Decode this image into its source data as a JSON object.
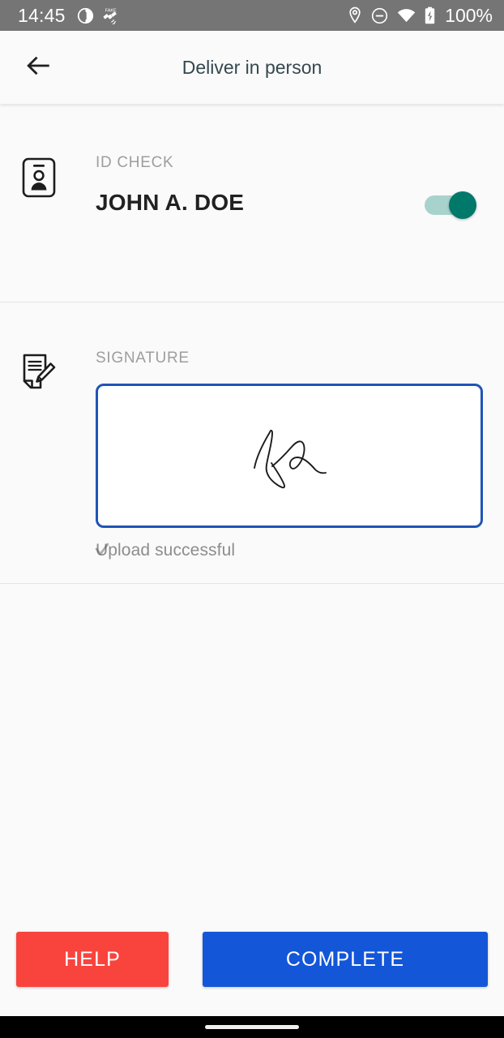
{
  "status_bar": {
    "time": "14:45",
    "battery_percent": "100%",
    "left_icons": [
      "notification-app-icon",
      "fake-gps-satellite-icon"
    ],
    "right_icons": [
      "location-pin-icon",
      "do-not-disturb-icon",
      "wifi-icon",
      "battery-charging-icon"
    ],
    "background_color": "#757575",
    "foreground_color": "#ffffff"
  },
  "app_bar": {
    "title": "Deliver in person",
    "back_icon": "arrow-left-icon"
  },
  "id_check": {
    "label": "ID CHECK",
    "name": "JOHN A. DOE",
    "icon": "id-badge-icon",
    "toggle_state": "on",
    "toggle_thumb_color": "#00796b",
    "toggle_track_color": "#a8d3cc"
  },
  "signature": {
    "label": "SIGNATURE",
    "icon": "document-pencil-icon",
    "box_border_color": "#1f55b5",
    "has_signature": true,
    "status_icon": "check-icon",
    "status_text": "Upload successful"
  },
  "actions": {
    "help_label": "HELP",
    "help_color": "#f9443e",
    "complete_label": "COMPLETE",
    "complete_color": "#1356d8"
  },
  "nav_bar": {
    "gesture_pill": "home-gesture-pill"
  }
}
